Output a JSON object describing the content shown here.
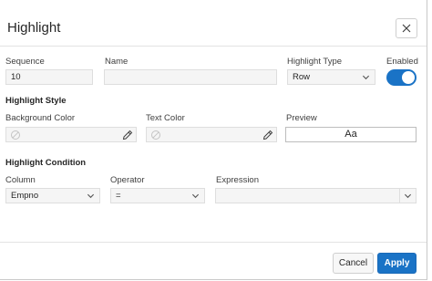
{
  "dialog": {
    "title": "Highlight",
    "close_icon": "close-icon"
  },
  "fields": {
    "sequence": {
      "label": "Sequence",
      "value": "10"
    },
    "name": {
      "label": "Name",
      "value": ""
    },
    "highlight_type": {
      "label": "Highlight Type",
      "value": "Row"
    },
    "enabled": {
      "label": "Enabled",
      "on": true
    }
  },
  "style_section": {
    "title": "Highlight Style",
    "background_color": {
      "label": "Background Color",
      "value": ""
    },
    "text_color": {
      "label": "Text Color",
      "value": ""
    },
    "preview": {
      "label": "Preview",
      "sample": "Aa"
    }
  },
  "condition_section": {
    "title": "Highlight Condition",
    "column": {
      "label": "Column",
      "value": "Empno"
    },
    "operator": {
      "label": "Operator",
      "value": "="
    },
    "expression": {
      "label": "Expression",
      "value": ""
    }
  },
  "buttons": {
    "cancel": "Cancel",
    "apply": "Apply"
  },
  "colors": {
    "accent": "#1a73c6",
    "field_bg": "#f5f5f5",
    "border": "#dedede"
  }
}
